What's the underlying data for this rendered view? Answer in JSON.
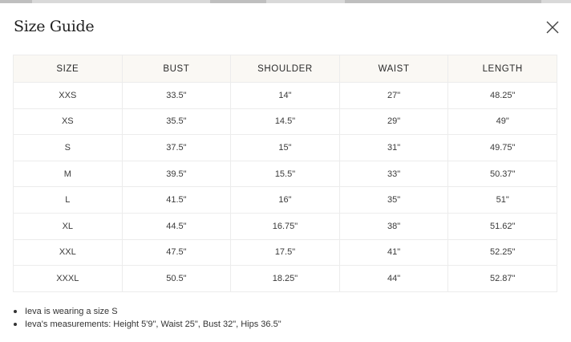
{
  "modal": {
    "title": "Size Guide",
    "close_icon": "close-icon"
  },
  "table": {
    "headers": [
      "SIZE",
      "BUST",
      "SHOULDER",
      "WAIST",
      "LENGTH"
    ],
    "rows": [
      [
        "XXS",
        "33.5\"",
        "14\"",
        "27\"",
        "48.25\""
      ],
      [
        "XS",
        "35.5\"",
        "14.5\"",
        "29\"",
        "49\""
      ],
      [
        "S",
        "37.5\"",
        "15\"",
        "31\"",
        "49.75\""
      ],
      [
        "M",
        "39.5\"",
        "15.5\"",
        "33\"",
        "50.37\""
      ],
      [
        "L",
        "41.5\"",
        "16\"",
        "35\"",
        "51\""
      ],
      [
        "XL",
        "44.5\"",
        "16.75\"",
        "38\"",
        "51.62\""
      ],
      [
        "XXL",
        "47.5\"",
        "17.5\"",
        "41\"",
        "52.25\""
      ],
      [
        "XXXL",
        "50.5\"",
        "18.25\"",
        "44\"",
        "52.87\""
      ]
    ]
  },
  "notes": [
    "Ieva is wearing a size S",
    "Ieva's measurements: Height 5'9\", Waist 25\", Bust 32\", Hips 36.5\""
  ],
  "colors": {
    "header_bg": "#faf8f4",
    "border": "#ececec",
    "text": "#2b2b2b"
  }
}
